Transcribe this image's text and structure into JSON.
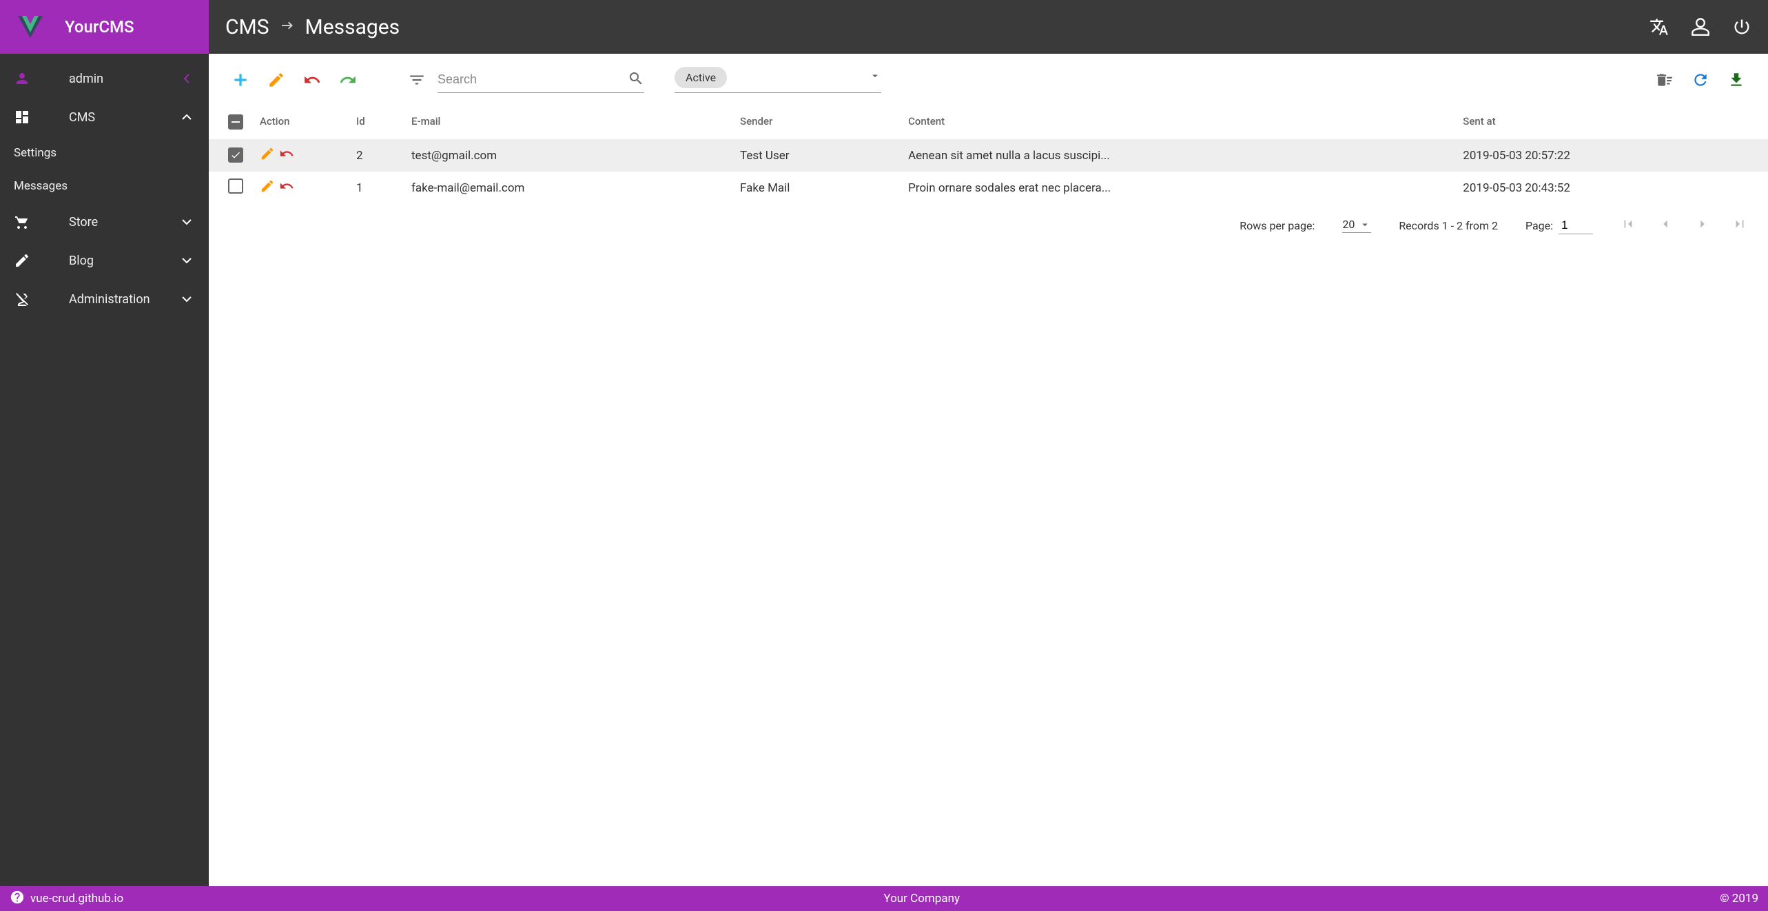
{
  "brand": {
    "name": "YourCMS"
  },
  "breadcrumb": {
    "root": "CMS",
    "page": "Messages"
  },
  "sidebar": {
    "user": "admin",
    "items": [
      {
        "label": "CMS",
        "expanded": true
      },
      {
        "label": "Store",
        "expanded": false
      },
      {
        "label": "Blog",
        "expanded": false
      },
      {
        "label": "Administration",
        "expanded": false
      }
    ],
    "cms_sub": [
      {
        "label": "Settings"
      },
      {
        "label": "Messages"
      }
    ]
  },
  "toolbar": {
    "search_placeholder": "Search",
    "status_chip": "Active"
  },
  "table": {
    "headers": {
      "action": "Action",
      "id": "Id",
      "email": "E-mail",
      "sender": "Sender",
      "content": "Content",
      "sent_at": "Sent at"
    },
    "rows": [
      {
        "id": "2",
        "email": "test@gmail.com",
        "sender": "Test User",
        "content": "Aenean sit amet nulla a lacus suscipi...",
        "sent_at": "2019-05-03 20:57:22",
        "selected": true
      },
      {
        "id": "1",
        "email": "fake-mail@email.com",
        "sender": "Fake Mail",
        "content": "Proin ornare sodales erat nec placera...",
        "sent_at": "2019-05-03 20:43:52",
        "selected": false
      }
    ]
  },
  "pagination": {
    "rpp_label": "Rows per page:",
    "rpp_value": "20",
    "records_text": "Records 1 - 2 from 2",
    "page_label": "Page:",
    "page_value": "1"
  },
  "footer": {
    "link": "vue-crud.github.io",
    "company": "Your Company",
    "copyright": "© 2019"
  }
}
